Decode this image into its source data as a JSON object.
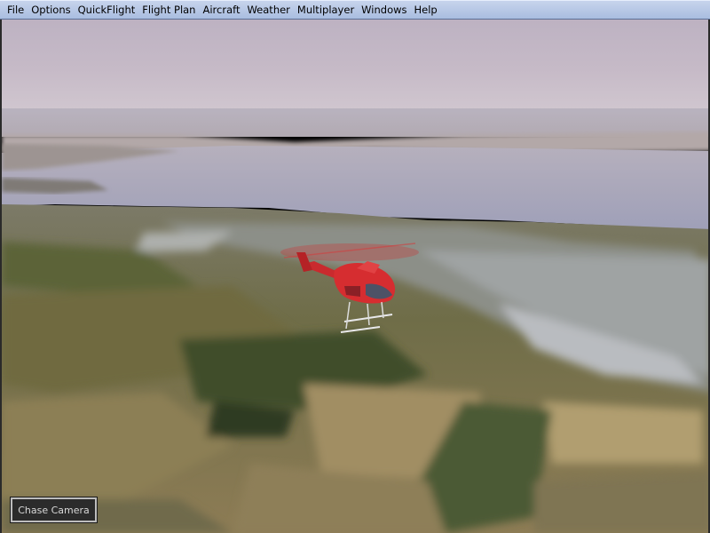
{
  "menubar": {
    "items": [
      {
        "label": "File"
      },
      {
        "label": "Options"
      },
      {
        "label": "QuickFlight"
      },
      {
        "label": "Flight Plan"
      },
      {
        "label": "Aircraft"
      },
      {
        "label": "Weather"
      },
      {
        "label": "Multiplayer"
      },
      {
        "label": "Windows"
      },
      {
        "label": "Help"
      }
    ]
  },
  "viewport": {
    "chase_camera_label": "Chase Camera"
  },
  "colors": {
    "menubar": "#b8c9e8",
    "sky_top": "#b9aebf",
    "water": "#a8a7bd",
    "terrain": "#8c7e57",
    "helicopter": "#d42a2a"
  },
  "icons": [
    "helicopter-aircraft"
  ]
}
